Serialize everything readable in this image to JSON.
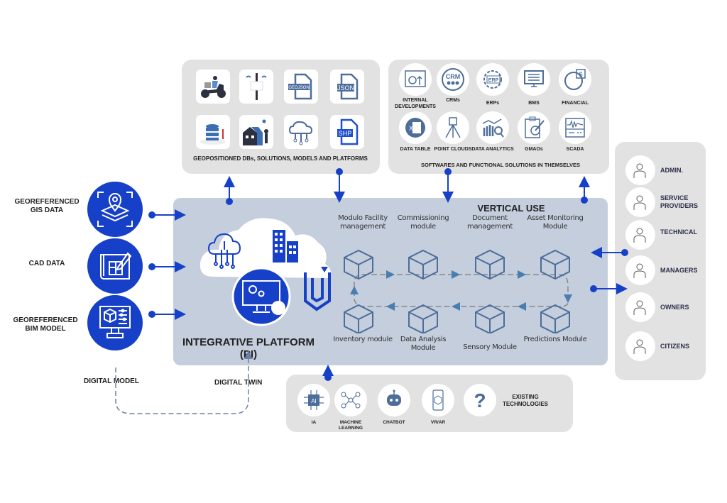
{
  "colors": {
    "accent_blue": "#1740c8",
    "module_blue": "#4d6d9a",
    "panel_gray": "#e2e2e2",
    "platform_bg": "#c4cedd",
    "text_dark": "#222222",
    "user_text": "#2b2f4a"
  },
  "geo_panel": {
    "title": "GEOPOSITIONED DBs, SOLUTIONS, MODELS AND PLATFORMS",
    "items": [
      {
        "icon": "scooter-delivery-icon"
      },
      {
        "icon": "antenna-sensor-icon"
      },
      {
        "icon": "geojson-file-icon",
        "text": "GEOJSON"
      },
      {
        "icon": "json-file-icon",
        "text": "JSON"
      },
      {
        "icon": "database-icon"
      },
      {
        "icon": "house-location-icon"
      },
      {
        "icon": "cloud-network-icon"
      },
      {
        "icon": "shp-file-icon",
        "text": "SHP"
      }
    ]
  },
  "software_panel": {
    "title": "SOFTWARES AND FUNCTIONAL SOLUTIONS IN THEMSELVES",
    "items": [
      {
        "label": "INTERNAL DEVELOPMENTS",
        "icon": "gear-code-icon"
      },
      {
        "label": "CRMs",
        "icon": "crm-icon",
        "text": "CRM"
      },
      {
        "label": "ERPs",
        "icon": "erp-gear-icon",
        "text": "ERP"
      },
      {
        "label": "BMS",
        "icon": "monitor-icon"
      },
      {
        "label": "FINANCIAL",
        "icon": "pie-dollar-icon"
      },
      {
        "label": "DATA TABLE",
        "icon": "excel-icon"
      },
      {
        "label": "POINT CLOUDS",
        "icon": "tripod-scanner-icon"
      },
      {
        "label": "DATA ANALYTICS",
        "icon": "bar-chart-search-icon"
      },
      {
        "label": "GMAOs",
        "icon": "clipboard-gear-icon"
      },
      {
        "label": "SCADA",
        "icon": "waveform-panel-icon"
      }
    ]
  },
  "inputs": [
    {
      "label": "GEOREFERENCED GIS DATA",
      "icon": "map-layers-pin-icon"
    },
    {
      "label": "CAD DATA",
      "icon": "blueprint-pencil-icon"
    },
    {
      "label": "GEOREFERENCED BIM MODEL",
      "icon": "monitor-cube-icon"
    }
  ],
  "platform": {
    "title_line1": "INTEGRATIVE PLATFORM",
    "title_line2": "(PI)",
    "vertical_use": "VERTICAL USE",
    "modules_top": [
      "Modulo Facility management",
      "Commissioning module",
      "Document management",
      "Asset Monitoring Module"
    ],
    "modules_bottom": [
      "Inventory module",
      "Data Analysis Module",
      "Sensory Module",
      "Predictions Module"
    ]
  },
  "users": [
    {
      "label": "ADMIN.",
      "icon": "admin-user-icon"
    },
    {
      "label": "SERVICE PROVIDERS",
      "icon": "service-provider-icon"
    },
    {
      "label": "TECHNICAL",
      "icon": "technician-icon"
    },
    {
      "label": "MANAGERS",
      "icon": "manager-icon"
    },
    {
      "label": "OWNERS",
      "icon": "owner-house-icon"
    },
    {
      "label": "CITIZENS",
      "icon": "citizens-group-icon"
    }
  ],
  "technologies": {
    "title": "EXISTING TECHNOLOGIES",
    "items": [
      {
        "label": "IA",
        "icon": "ai-chip-icon",
        "text": "AI"
      },
      {
        "label": "MACHINE LEARNING",
        "icon": "neural-network-icon"
      },
      {
        "label": "CHATBOT",
        "icon": "chatbot-icon"
      },
      {
        "label": "VR/AR",
        "icon": "vr-phone-icon"
      },
      {
        "label": "",
        "icon": "question-mark-icon",
        "text": "?"
      }
    ]
  },
  "loop_labels": {
    "digital_model": "DIGITAL MODEL",
    "digital_twin": "DIGITAL TWIN"
  }
}
